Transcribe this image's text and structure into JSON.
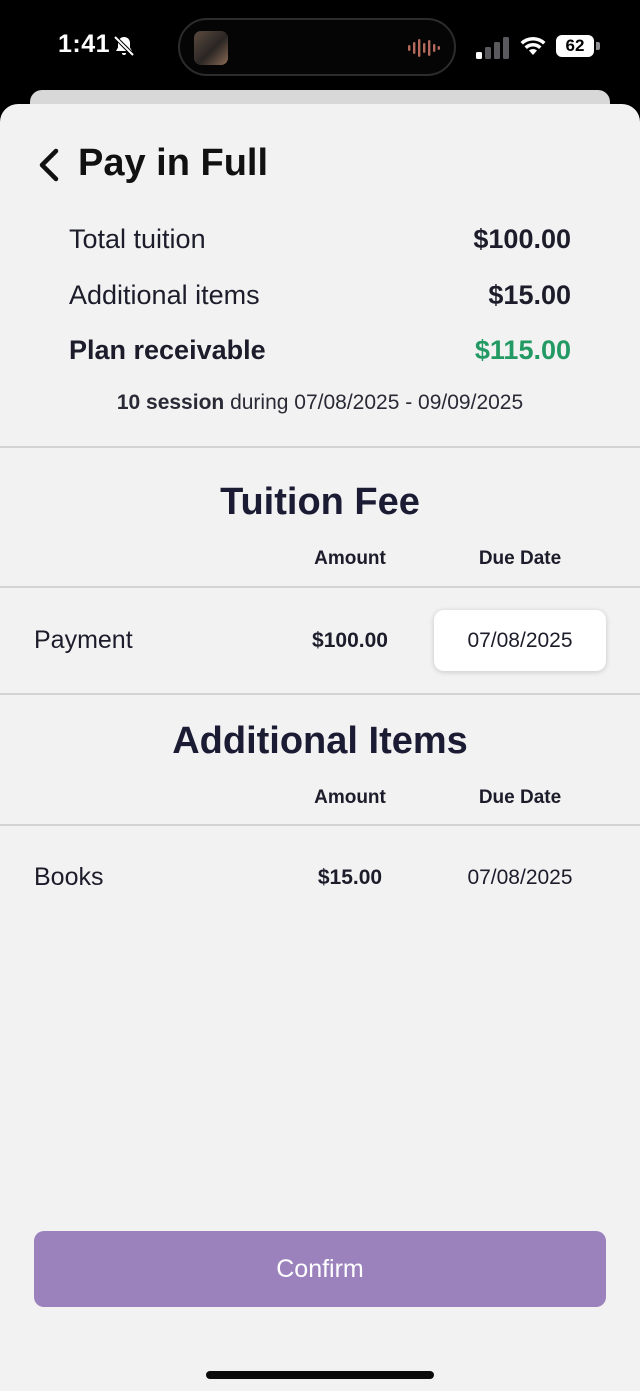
{
  "status_bar": {
    "time": "1:41",
    "battery": "62",
    "icons": [
      "bell-slash-icon",
      "signal-icon",
      "wifi-icon",
      "battery-icon",
      "audio-waveform-icon"
    ]
  },
  "header": {
    "title": "Pay in Full",
    "back_icon": "chevron-left-icon"
  },
  "summary": {
    "total_tuition_label": "Total tuition",
    "total_tuition_value": "$100.00",
    "additional_items_label": "Additional items",
    "additional_items_value": "$15.00",
    "plan_receivable_label": "Plan receivable",
    "plan_receivable_value": "$115.00",
    "session_count": "10 session",
    "session_period": "during 07/08/2025 - 09/09/2025"
  },
  "tuition_fee": {
    "title": "Tuition Fee",
    "col_amount": "Amount",
    "col_due_date": "Due Date",
    "rows": [
      {
        "label": "Payment",
        "amount": "$100.00",
        "due_date": "07/08/2025"
      }
    ]
  },
  "additional_items": {
    "title": "Additional Items",
    "col_amount": "Amount",
    "col_due_date": "Due Date",
    "rows": [
      {
        "label": "Books",
        "amount": "$15.00",
        "due_date": "07/08/2025"
      }
    ]
  },
  "confirm": {
    "label": "Confirm"
  },
  "colors": {
    "accent_purple": "#9b82bd",
    "receivable_green": "#239a63",
    "background": "#f2f2f2"
  }
}
